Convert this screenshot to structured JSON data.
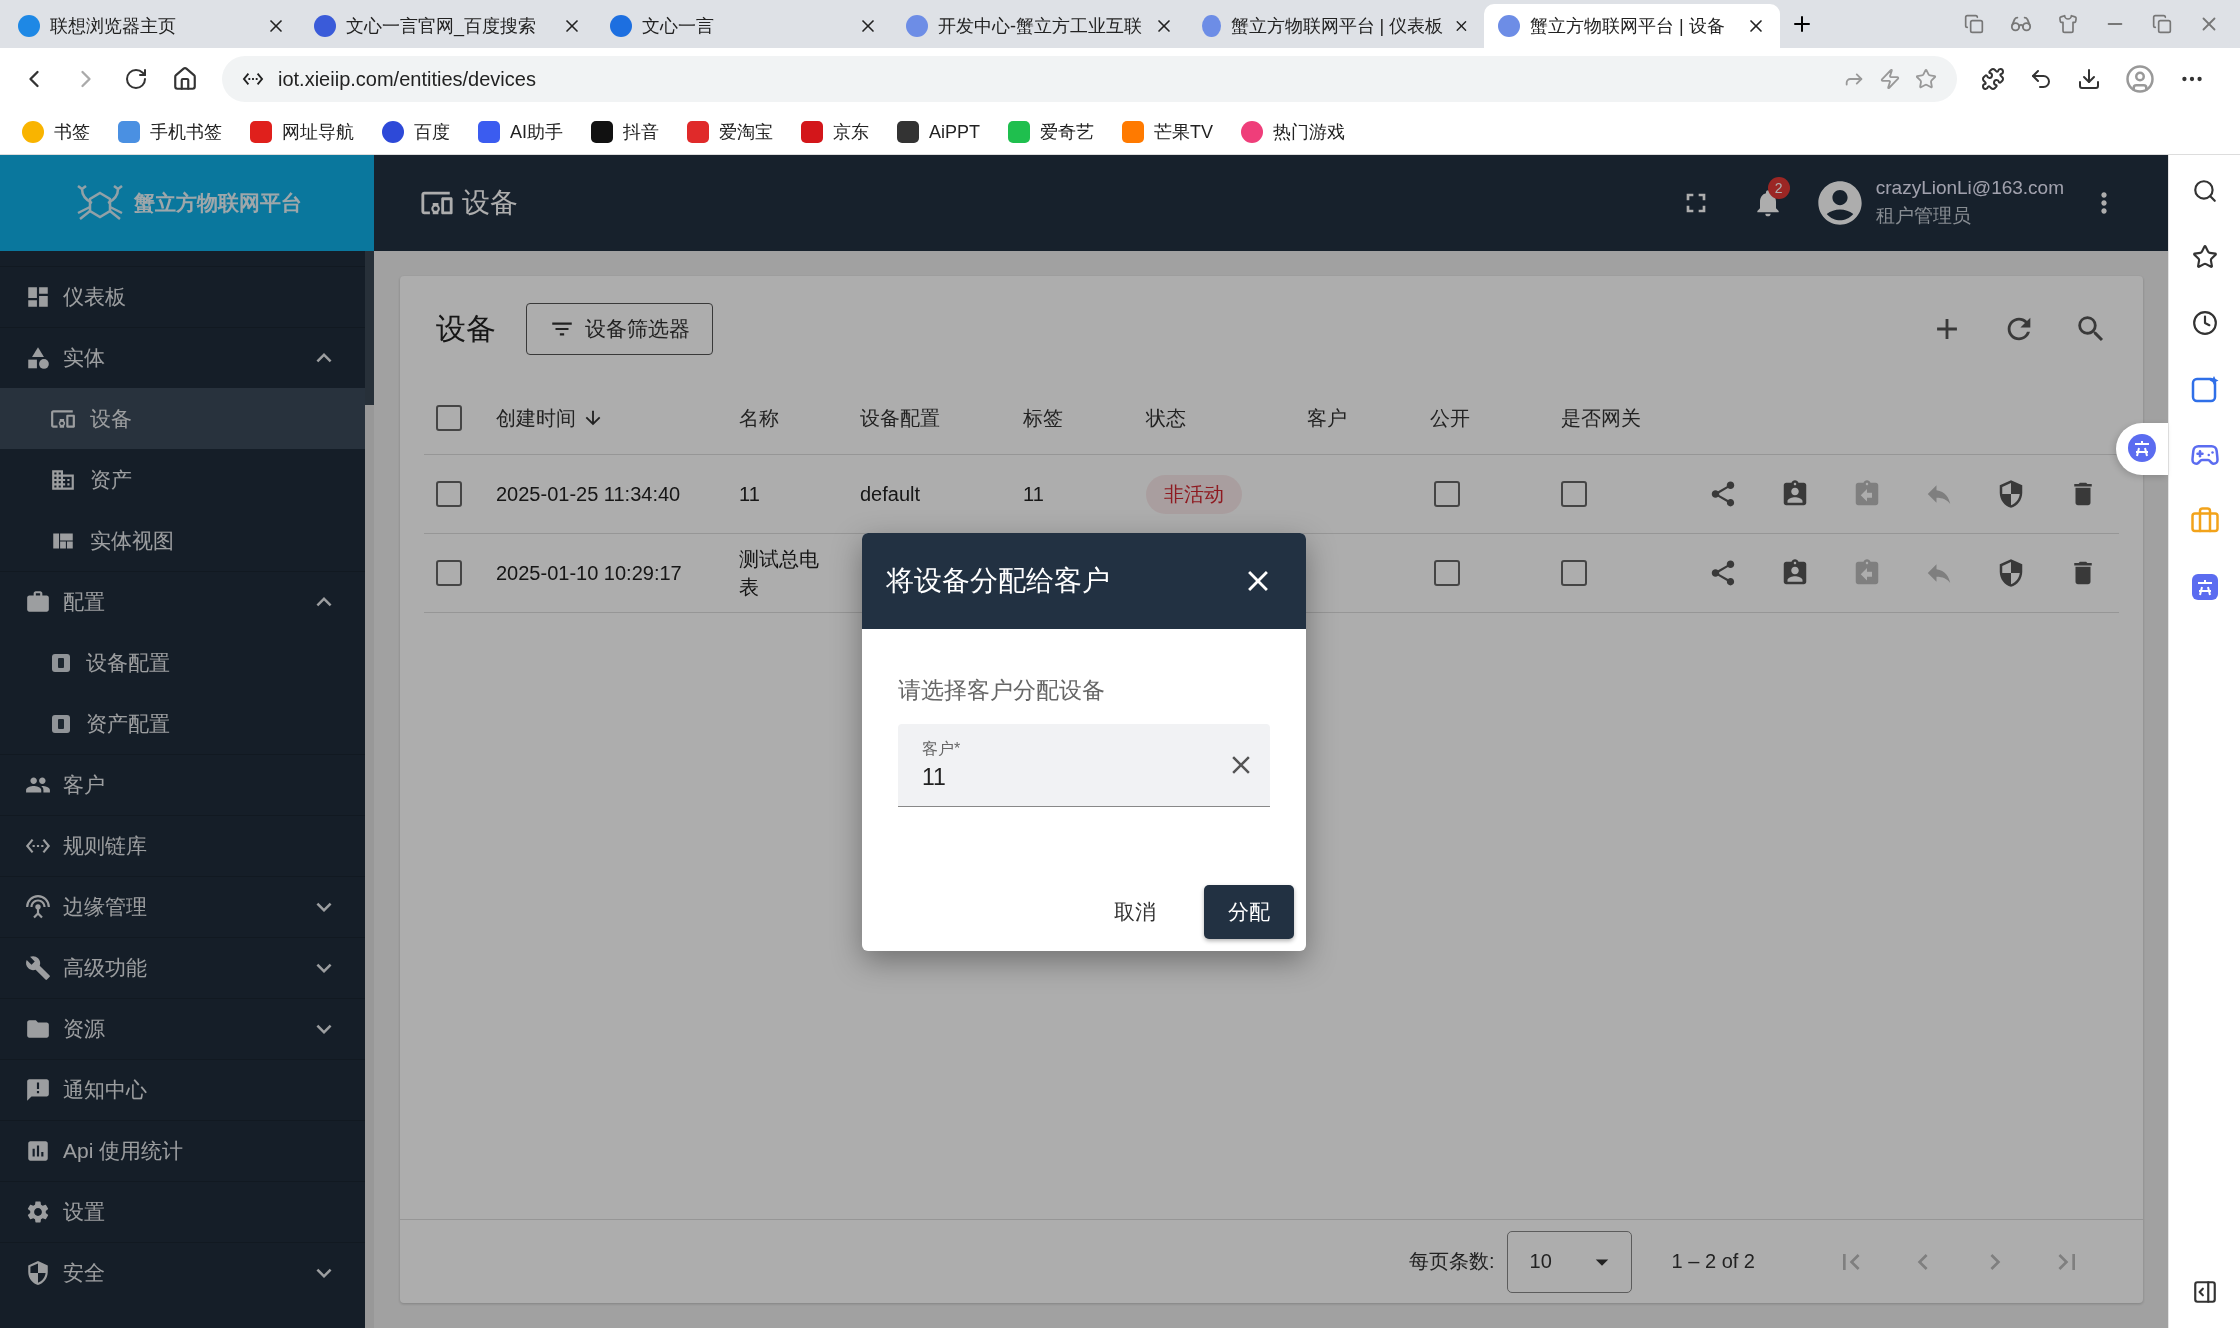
{
  "browser": {
    "tabs": [
      {
        "title": "联想浏览器主页",
        "selected": false
      },
      {
        "title": "文心一言官网_百度搜索",
        "selected": false
      },
      {
        "title": "文心一言",
        "selected": false
      },
      {
        "title": "开发中心-蟹立方工业互联",
        "selected": false
      },
      {
        "title": "蟹立方物联网平台 | 仪表板",
        "selected": false
      },
      {
        "title": "蟹立方物联网平台 | 设备",
        "selected": true
      }
    ],
    "address": "iot.xieiip.com/entities/devices",
    "bookmarks": [
      "书签",
      "手机书签",
      "网址导航",
      "百度",
      "AI助手",
      "抖音",
      "爱淘宝",
      "京东",
      "AiPPT",
      "爱奇艺",
      "芒果TV",
      "热门游戏"
    ]
  },
  "app": {
    "logo_text": "蟹立方物联网平台",
    "sidebar": [
      {
        "label": "仪表板",
        "selected": false
      },
      {
        "label": "实体",
        "selected": false,
        "expanded": true,
        "children": [
          {
            "label": "设备",
            "selected": true
          },
          {
            "label": "资产",
            "selected": false
          },
          {
            "label": "实体视图",
            "selected": false
          }
        ]
      },
      {
        "label": "配置",
        "selected": false,
        "expanded": true,
        "children": [
          {
            "label": "设备配置",
            "selected": false
          },
          {
            "label": "资产配置",
            "selected": false
          }
        ]
      },
      {
        "label": "客户",
        "selected": false
      },
      {
        "label": "规则链库",
        "selected": false
      },
      {
        "label": "边缘管理",
        "selected": false,
        "expanded": false
      },
      {
        "label": "高级功能",
        "selected": false,
        "expanded": false
      },
      {
        "label": "资源",
        "selected": false,
        "expanded": false
      },
      {
        "label": "通知中心",
        "selected": false
      },
      {
        "label": "Api 使用统计",
        "selected": false
      },
      {
        "label": "设置",
        "selected": false
      },
      {
        "label": "安全",
        "selected": false,
        "expanded": false
      }
    ],
    "topbar": {
      "title": "设备",
      "notifications": "2",
      "user_email": "crazyLionLi@163.com",
      "user_role": "租户管理员"
    },
    "card": {
      "title": "设备",
      "filter_button": "设备筛选器"
    },
    "table": {
      "all_selected": false,
      "columns": [
        {
          "label": "创建时间",
          "sorted": true
        },
        {
          "label": "名称",
          "sorted": false
        },
        {
          "label": "设备配置",
          "sorted": false
        },
        {
          "label": "标签",
          "sorted": false
        },
        {
          "label": "状态",
          "sorted": false
        },
        {
          "label": "客户",
          "sorted": false
        },
        {
          "label": "公开",
          "sorted": false
        },
        {
          "label": "是否网关",
          "sorted": false
        }
      ],
      "rows": [
        {
          "selected": false,
          "created": "2025-01-25 11:34:40",
          "name": "11",
          "profile": "default",
          "label": "11",
          "status": {
            "text": "非活动",
            "active": false
          },
          "public": false,
          "gateway": false,
          "actions": [
            {
              "disabled": false
            },
            {
              "disabled": false
            },
            {
              "disabled": true
            },
            {
              "disabled": true
            },
            {
              "disabled": false
            },
            {
              "disabled": false
            }
          ]
        },
        {
          "selected": false,
          "created": "2025-01-10 10:29:17",
          "name": "测试总电表",
          "public": false,
          "gateway": false,
          "actions": [
            {
              "disabled": false
            },
            {
              "disabled": false
            },
            {
              "disabled": true
            },
            {
              "disabled": true
            },
            {
              "disabled": false
            },
            {
              "disabled": false
            }
          ]
        }
      ]
    },
    "pagination": {
      "page_size_label": "每页条数:",
      "page_size": "10",
      "range": "1 – 2 of 2",
      "nav": [
        {
          "disabled": true
        },
        {
          "disabled": true
        },
        {
          "disabled": true
        },
        {
          "disabled": true
        }
      ]
    }
  },
  "dialog": {
    "title": "将设备分配给客户",
    "prompt": "请选择客户分配设备",
    "field": {
      "label": "客户*",
      "value": "11"
    },
    "buttons": [
      {
        "label": "取消",
        "kind": "text"
      },
      {
        "label": "分配",
        "kind": "primary"
      }
    ]
  }
}
